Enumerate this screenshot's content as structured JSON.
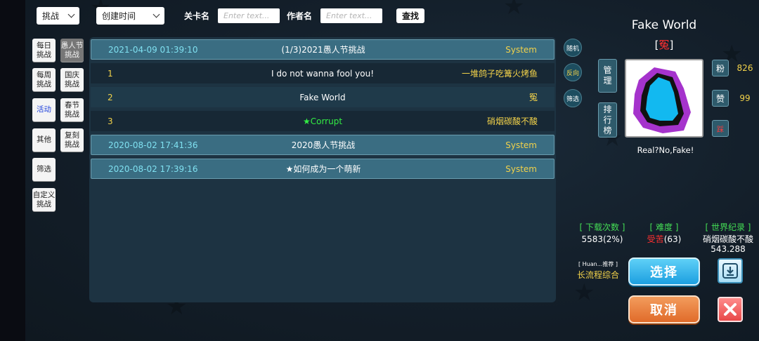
{
  "toolbar": {
    "mode_select": "挑战",
    "sort_select": "创建时间",
    "level_name_label": "关卡名",
    "level_name_placeholder": "Enter text...",
    "author_label": "作者名",
    "author_placeholder": "Enter text...",
    "find_button": "查找"
  },
  "categories": [
    {
      "label": "每日\n挑战"
    },
    {
      "label": "愚人节\n挑战"
    },
    {
      "label": "每周\n挑战"
    },
    {
      "label": "国庆\n挑战"
    },
    {
      "label": "活动"
    },
    {
      "label": "春节\n挑战"
    },
    {
      "label": "其他"
    },
    {
      "label": "复刻\n挑战"
    },
    {
      "label": "筛选"
    },
    {
      "label": "自定义\n挑战"
    }
  ],
  "list": {
    "rows": [
      {
        "col1": "2021-04-09 01:39:10",
        "col2": "(1/3)2021愚人节挑战",
        "col3": "System"
      },
      {
        "col1": "1",
        "col2": "I do not wanna fool you!",
        "col3": "一堆鸽子吃篝火烤鱼"
      },
      {
        "col1": "2",
        "col2": "Fake World",
        "col3": "冤"
      },
      {
        "col1": "3",
        "col2": "★Corrupt",
        "col3": "硝烟碳酸不酸"
      },
      {
        "col1": "2020-08-02 17:41:36",
        "col2": "2020愚人节挑战",
        "col3": "System"
      },
      {
        "col1": "2020-08-02 17:39:16",
        "col2": "★如何成为一个萌新",
        "col3": "System"
      }
    ]
  },
  "side_buttons": {
    "random": "随机",
    "reverse": "反向",
    "filter": "筛选"
  },
  "detail": {
    "title": "Fake World",
    "bracket_open": "[",
    "author": "冤",
    "bracket_close": "]",
    "manage_button": "管\n理",
    "ranking_button": "排\n行\n榜",
    "caption": "Real?No,Fake!",
    "fans_label": "粉",
    "fans_count": "826",
    "likes_label": "赞",
    "likes_count": "99",
    "report_label": "踩",
    "downloads_label": "[ 下载次数 ]",
    "downloads_value": "5583(2%)",
    "difficulty_label": "[ 难度 ]",
    "difficulty_name": "受苦",
    "difficulty_value": "(63)",
    "world_record_label": "[ 世界纪录 ]",
    "world_record_holder": "硝烟碳酸不酸",
    "world_record_time": "543.288",
    "recommend_label": "[ Huan...推荐 ]",
    "recommend_value": "长流程综合",
    "select_button": "选择",
    "cancel_button": "取消"
  },
  "colors": {
    "accent_yellow": "#f2d24a",
    "accent_green": "#44dd55",
    "accent_red": "#ff3030",
    "select_blue": "#1c9fe0",
    "cancel_orange": "#e06b2a"
  },
  "icons": [
    "download-icon",
    "close-icon"
  ]
}
